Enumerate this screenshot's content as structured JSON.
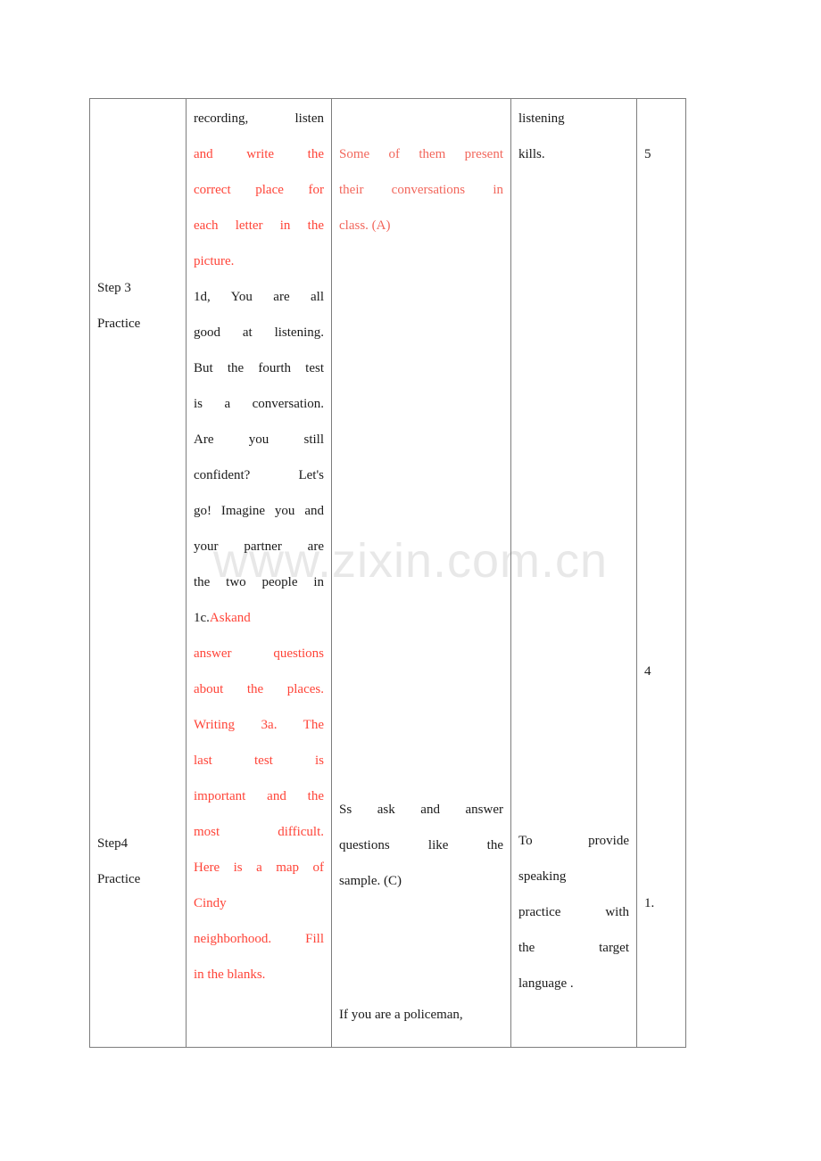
{
  "document": {
    "watermark": "www.zixin.com.cn",
    "text_color_normal": "#1a1a1a",
    "text_color_highlight": "#ff4438",
    "border_color": "#7d7d7d"
  },
  "table": {
    "rows": [
      {
        "step": {
          "line1": "Step 3",
          "line2": "Practice"
        },
        "teacher_activity": {
          "lines": [
            {
              "text": "recording,  listen",
              "color": "mixed",
              "justify": true
            },
            {
              "text": "and   write   the",
              "color": "red",
              "justify": true
            },
            {
              "text": "correct place for",
              "color": "red",
              "justify": true
            },
            {
              "text": "each letter in the",
              "color": "red",
              "justify": true
            },
            {
              "text": "picture.",
              "color": "red",
              "justify": false
            },
            {
              "text": "1d, You are all",
              "color": "normal",
              "justify": true
            },
            {
              "text": "good at listening.",
              "color": "normal",
              "justify": true
            },
            {
              "text": "But the fourth test",
              "color": "normal",
              "justify": true
            },
            {
              "text": "is a conversation.",
              "color": "normal",
              "justify": true
            },
            {
              "text": "Are you still",
              "color": "normal",
              "justify": true
            },
            {
              "text": "confident? Let's",
              "color": "normal",
              "justify": true
            },
            {
              "text": "go! Imagine you and",
              "color": "normal",
              "justify": true
            },
            {
              "text": "your partner are",
              "color": "normal",
              "justify": true
            },
            {
              "text": "the two people in",
              "color": "normal",
              "justify": true
            },
            {
              "text": "1c.  Ask  and",
              "color": "mixed",
              "justify": true
            }
          ],
          "plain_words": {
            "recording": "recording,",
            "listen_red": "listen",
            "onec": "1c.",
            "ask_red": "Ask",
            "and_red": "and"
          }
        },
        "student_activity": {
          "lines": [
            {
              "text": "Some of them present",
              "color": "red"
            },
            {
              "text": "their conversations in",
              "color": "red"
            },
            {
              "text": "class. (A)",
              "color": "red"
            }
          ]
        },
        "teaching_aim": {
          "lines": [
            {
              "text": "listening",
              "color": "normal"
            },
            {
              "text": "kills.",
              "color": "normal"
            }
          ]
        },
        "time": "5"
      },
      {
        "step": {
          "line1": "Step4",
          "line2": "Practice"
        },
        "teacher_activity": {
          "lines": [
            {
              "text": "answer  questions",
              "color": "red",
              "justify": true
            },
            {
              "text": "about the places.",
              "color": "red",
              "justify": true
            },
            {
              "text": "Writing 3a.  The",
              "color": "red",
              "justify": true
            },
            {
              "text": "last   test   is",
              "color": "red",
              "justify": true
            },
            {
              "text": "important and the",
              "color": "red",
              "justify": true
            },
            {
              "text": "most  difficult.",
              "color": "red",
              "justify": true
            },
            {
              "text": "Here is a map of",
              "color": "red",
              "justify": true
            },
            {
              "text": "Cindy",
              "color": "red",
              "justify": false
            },
            {
              "text": "neighborhood. Fill",
              "color": "red",
              "justify": true
            },
            {
              "text": "in the blanks.",
              "color": "red",
              "justify": false
            }
          ]
        },
        "student_activity": {
          "lines": [
            {
              "text": "Ss ask and answer",
              "color": "normal"
            },
            {
              "text": "questions like the",
              "color": "normal"
            },
            {
              "text": "sample. (C)",
              "color": "normal"
            },
            {
              "text": "If you are a policeman,",
              "color": "normal"
            }
          ]
        },
        "teaching_aim": {
          "lines": [
            {
              "text": "To provide",
              "color": "normal"
            },
            {
              "text": "speaking",
              "color": "normal"
            },
            {
              "text": "practice with",
              "color": "normal"
            },
            {
              "text": "the target",
              "color": "normal"
            },
            {
              "text": "language .",
              "color": "normal"
            }
          ]
        },
        "time_mid": "4",
        "time_bottom": "1."
      }
    ]
  }
}
